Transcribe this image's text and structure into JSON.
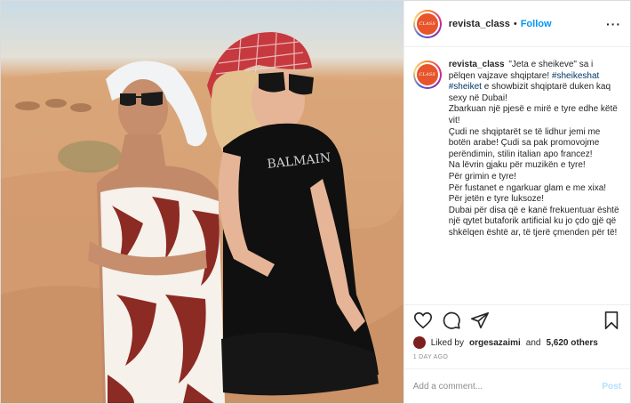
{
  "account": {
    "username": "revista_class",
    "avatar_text": "CLASS",
    "separator": "•",
    "follow_label": "Follow",
    "more_label": "···"
  },
  "caption": {
    "username": "revista_class",
    "lines": [
      "\"Jeta e sheikeve\" sa i pëlqen vajzave shqiptare!",
      "#sheikeshat",
      "#sheiket",
      "e showbizit shqiptarë duken kaq sexy në Dubai!",
      "Zbarkuan një pjesë e mirë e tyre edhe këtë vit!",
      "Çudi ne shqiptarët se të lidhur jemi me botën arabe! Çudi sa pak promovojme perëndimin, stilin italian apo francez!",
      "Na lëvrin gjaku për muzikën e tyre!",
      "Për grimin e tyre!",
      "Për fustanet e ngarkuar glam e me xixa!",
      "Për jetën e tyre luksoze!",
      "Dubai për disa që e kanë frekuentuar është një qytet butaforik artificial ku jo çdo gjë që shkëlqen është ar, të tjerë çmenden për të!"
    ]
  },
  "actions": {
    "like_icon": "heart-icon",
    "comment_icon": "comment-icon",
    "share_icon": "share-icon",
    "save_icon": "bookmark-icon"
  },
  "likes": {
    "prefix": "Liked by",
    "user": "orgesazaimi",
    "conj": "and",
    "others": "5,620 others"
  },
  "timestamp": "1 DAY AGO",
  "comment_box": {
    "placeholder": "Add a comment...",
    "post_label": "Post"
  },
  "colors": {
    "accent": "#0095f6",
    "avatar_bg": "#e8542b",
    "post_disabled": "#b2dffc"
  }
}
